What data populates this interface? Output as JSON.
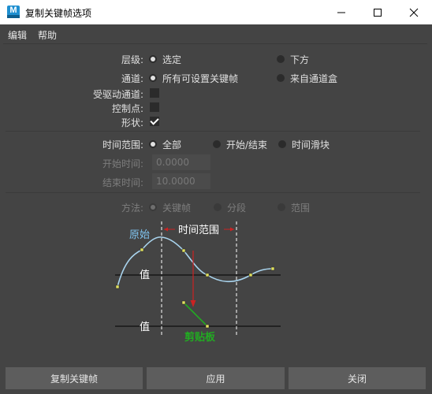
{
  "window": {
    "title": "复制关键帧选项",
    "app_icon_letter": "M"
  },
  "menu": {
    "items": [
      "编辑",
      "帮助"
    ]
  },
  "form": {
    "hierarchy": {
      "label": "层级:",
      "options": [
        "选定",
        "下方"
      ],
      "selected": "选定"
    },
    "channels": {
      "label": "通道:",
      "options": [
        "所有可设置关键帧",
        "来自通道盒"
      ],
      "selected": "所有可设置关键帧"
    },
    "driven_channels": {
      "label": "受驱动通道:",
      "checked": false
    },
    "control_points": {
      "label": "控制点:",
      "checked": false
    },
    "shapes": {
      "label": "形状:",
      "checked": true
    },
    "time_range": {
      "label": "时间范围:",
      "options": [
        "全部",
        "开始/结束",
        "时间滑块"
      ],
      "selected": "全部"
    },
    "start_time": {
      "label": "开始时间:",
      "value": "0.0000"
    },
    "end_time": {
      "label": "结束时间:",
      "value": "10.0000"
    },
    "method": {
      "label": "方法:",
      "options": [
        "关键帧",
        "分段",
        "范围"
      ],
      "selected": "关键帧"
    }
  },
  "diagram": {
    "original_label": "原始",
    "time_range_label": "时间范围",
    "value_label_top": "值",
    "value_label_bottom": "值",
    "clipboard_label": "剪贴板",
    "colors": {
      "curve": "#a9d4ee",
      "original": "#7fc4f0",
      "arrow": "#cc2222",
      "clip": "#22aa22",
      "key": "#e0e060"
    }
  },
  "buttons": {
    "copy_keys": "复制关键帧",
    "apply": "应用",
    "close": "关闭"
  }
}
